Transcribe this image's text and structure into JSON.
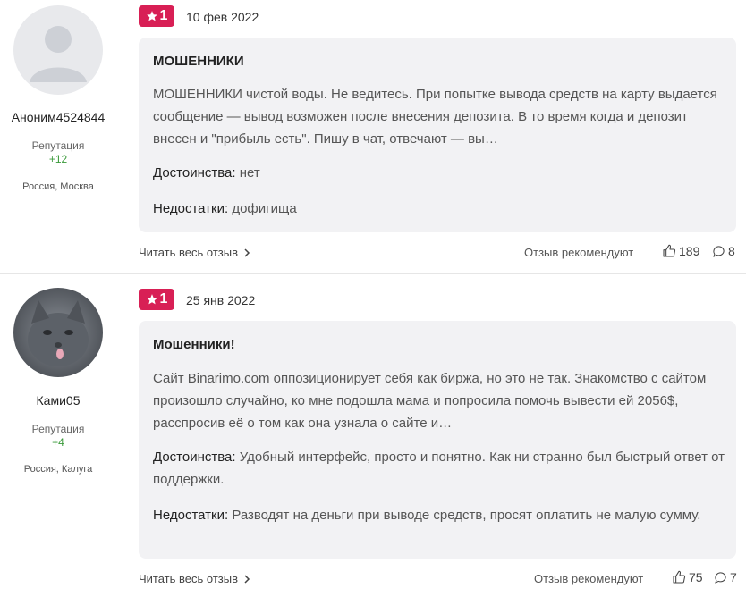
{
  "reviews": [
    {
      "author": {
        "name": "Аноним4524844",
        "reputation_label": "Репутация",
        "reputation_value": "+12",
        "location": "Россия, Москва"
      },
      "rating": "1",
      "date": "10 фев 2022",
      "title": "МОШЕННИКИ",
      "text": "МОШЕННИКИ чистой воды. Не ведитесь. При попытке вывода средств на карту выдается сообщение — вывод возможен после внесения депозита. В то время когда и депозит внесен и \"прибыль есть\". Пишу в чат, отвечают — вы…",
      "pros_label": "Достоинства:",
      "pros": "нет",
      "cons_label": "Недостатки:",
      "cons": "дофигища",
      "read_more": "Читать весь отзыв",
      "recommend_label": "Отзыв рекомендуют",
      "likes": "189",
      "comments": "8"
    },
    {
      "author": {
        "name": "Ками05",
        "reputation_label": "Репутация",
        "reputation_value": "+4",
        "location": "Россия, Калуга"
      },
      "rating": "1",
      "date": "25 янв 2022",
      "title": "Мошенники!",
      "text": "Сайт Binarimo.com оппозиционирует себя как биржа, но это не так. Знакомство с сайтом произошло случайно, ко мне подошла мама и попросила помочь вывести ей 2056$, расспросив её о том как она узнала о сайте и…",
      "pros_label": "Достоинства:",
      "pros": "Удобный интерфейс, просто и понятно. Как ни странно был быстрый ответ от поддержки.",
      "cons_label": "Недостатки:",
      "cons": "Разводят на деньги при выводе средств, просят оплатить не малую сумму.",
      "read_more": "Читать весь отзыв",
      "recommend_label": "Отзыв рекомендуют",
      "likes": "75",
      "comments": "7"
    }
  ],
  "colors": {
    "badge": "#d81f55",
    "reputation": "#3a9a3a",
    "card_bg": "#f2f2f4"
  },
  "icons": [
    "star-icon",
    "chevron-right-icon",
    "thumbs-up-icon",
    "comment-icon",
    "default-avatar-icon",
    "cat-photo-avatar"
  ]
}
